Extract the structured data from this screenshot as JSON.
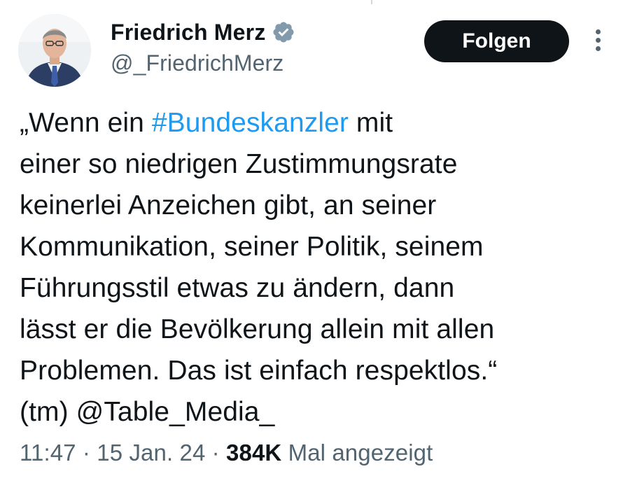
{
  "author": {
    "display_name": "Friedrich Merz",
    "handle": "@_FriedrichMerz",
    "verified_icon": "verified-badge-icon",
    "verified_color": "#829aab"
  },
  "actions": {
    "follow_label": "Folgen",
    "more_icon": "more-options-icon"
  },
  "tweet": {
    "line1_before": "„Wenn ein ",
    "hashtag": "#Bundeskanzler",
    "line1_after": " mit",
    "line2": "einer so niedrigen Zustimmungsrate",
    "line3": "keinerlei Anzeichen gibt, an seiner",
    "line4": "Kommunikation, seiner Politik, seinem",
    "line5": "Führungsstil etwas zu ändern, dann",
    "line6": "lässt er die Bevölkerung allein mit allen",
    "line7": "Problemen. Das ist einfach respektlos.“",
    "line8_before": "(tm) ",
    "mention": "@Table_Media_"
  },
  "meta": {
    "time": "11:47",
    "separator": " · ",
    "date": "15 Jan. 24",
    "views_count": "384K",
    "views_label": " Mal angezeigt"
  },
  "colors": {
    "text": "#0f1419",
    "secondary": "#536471",
    "link": "#1d9bf0",
    "button_bg": "#0f1419",
    "button_text": "#ffffff"
  }
}
